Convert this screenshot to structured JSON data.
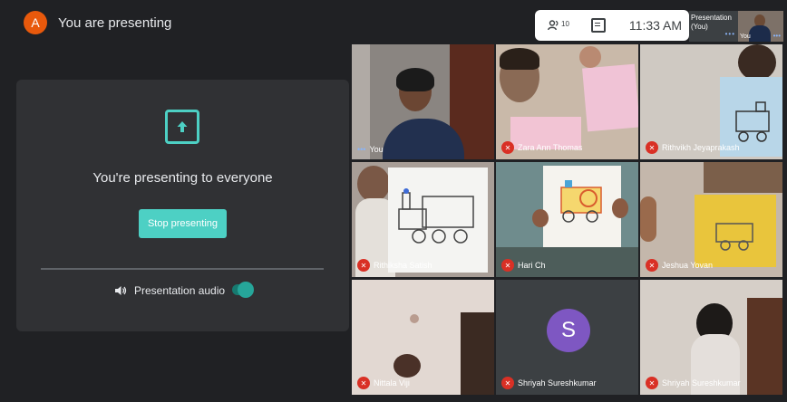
{
  "header": {
    "avatar_letter": "A",
    "status": "You are presenting"
  },
  "toolbar": {
    "people_count": "10",
    "time": "11:33 AM"
  },
  "mini_tiles": {
    "presentation_label": "Presentation (You)",
    "you_label": "You"
  },
  "presenting": {
    "message": "You're presenting to everyone",
    "stop_label": "Stop presenting",
    "audio_label": "Presentation audio"
  },
  "participants": [
    {
      "name": "You"
    },
    {
      "name": "Zara Ann Thomas"
    },
    {
      "name": "Rithvikh Jeyaprakash"
    },
    {
      "name": "Rithiksha Satish"
    },
    {
      "name": "Hari Ch"
    },
    {
      "name": "Jeshua Yovan"
    },
    {
      "name": "Nittala Viji"
    },
    {
      "name": "Shriyah Sureshkumar",
      "avatar_letter": "S"
    },
    {
      "name": "Shriyah Sureshkumar"
    }
  ],
  "colors": {
    "accent": "#4dd0c4",
    "mic_off": "#d93025",
    "avatar_bg": "#e8590c",
    "s_avatar": "#7e57c2"
  },
  "icons": [
    "people-icon",
    "chat-icon",
    "present-screen-icon",
    "speaker-icon",
    "mic-off-icon"
  ]
}
